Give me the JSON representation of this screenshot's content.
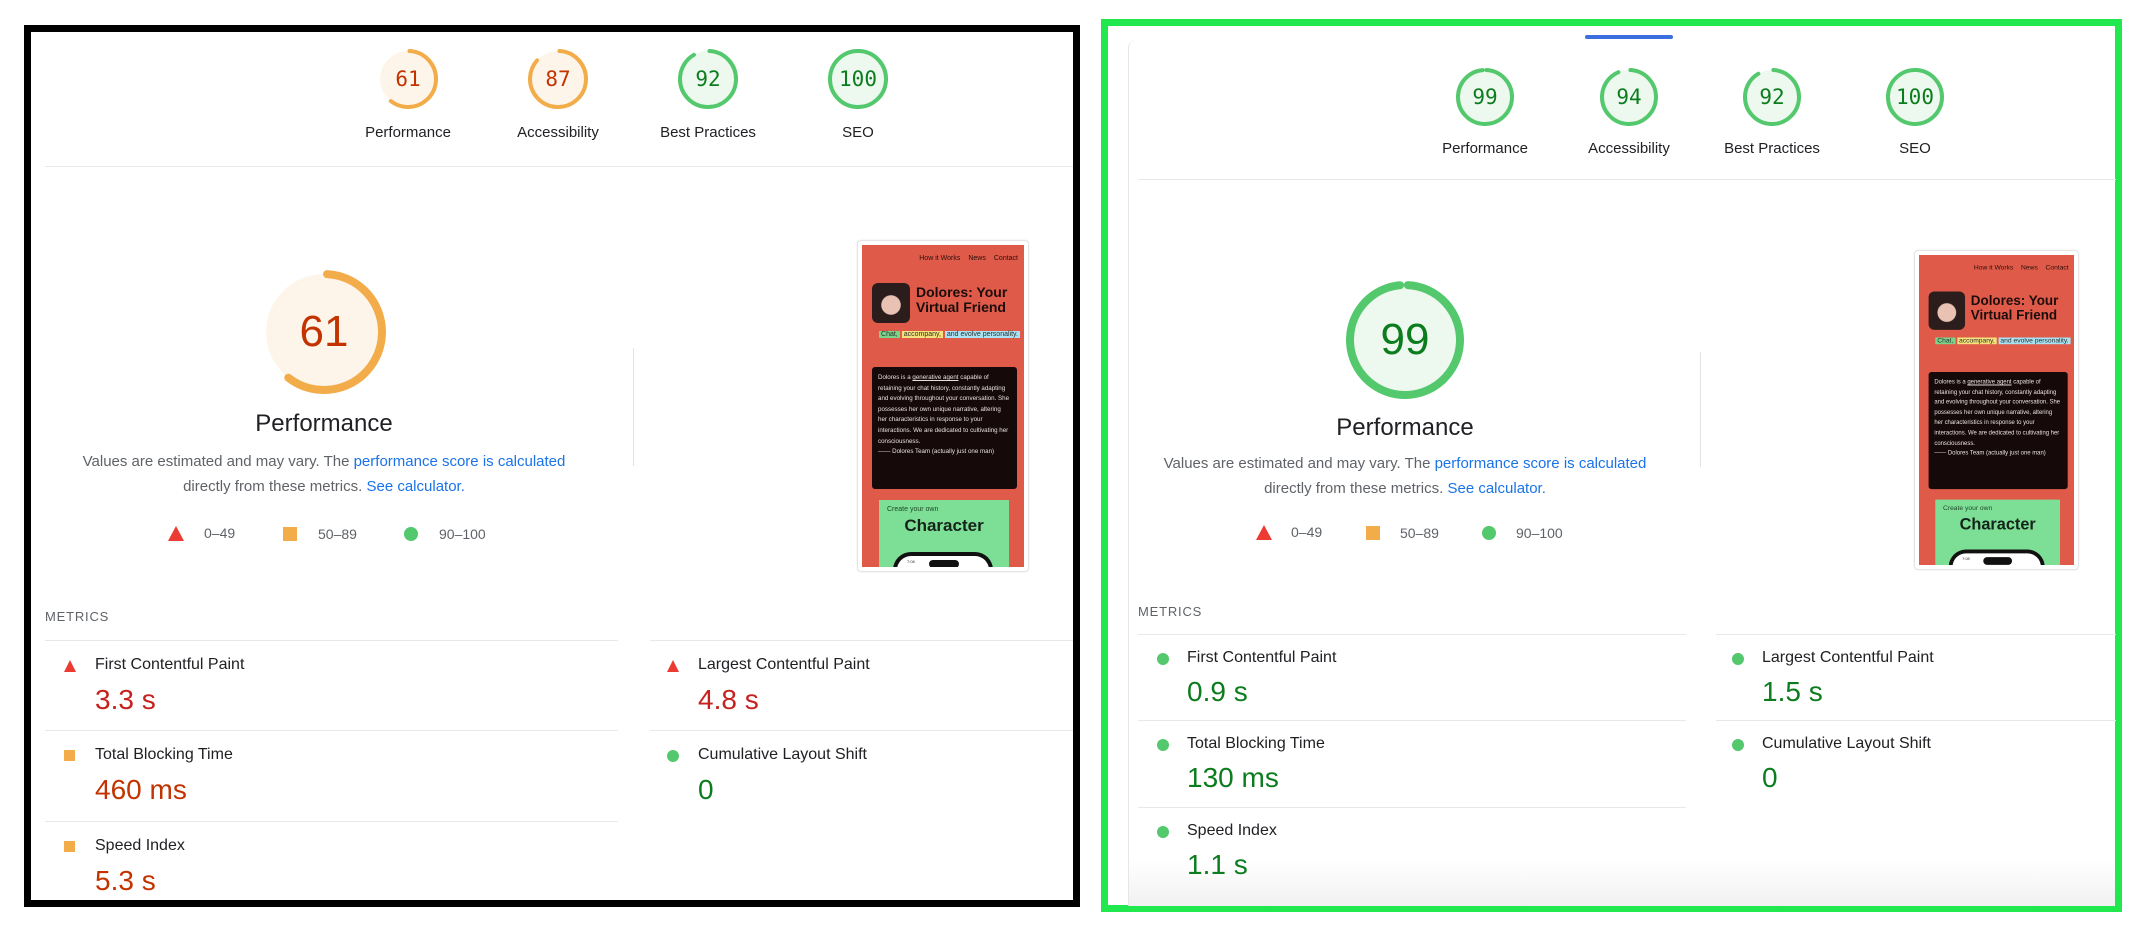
{
  "colors": {
    "pass": "#0c7d1e",
    "average": "#c33300",
    "fail": "#c5221f",
    "pass_ring": "#53c86c",
    "average_ring": "#f2ac4a",
    "fail_icon": "#eb3b32",
    "pass_bg": "#edf8ef",
    "average_bg": "#fdf5ea",
    "link": "#1a73e8",
    "left_frame": "#000000",
    "right_frame": "#22e84f"
  },
  "panels": [
    {
      "id": "before",
      "categories": [
        {
          "label": "Performance",
          "score": 61,
          "rating": "average"
        },
        {
          "label": "Accessibility",
          "score": 87,
          "rating": "average"
        },
        {
          "label": "Best Practices",
          "score": 92,
          "rating": "pass"
        },
        {
          "label": "SEO",
          "score": 100,
          "rating": "pass"
        }
      ],
      "main": {
        "score": 61,
        "rating": "average",
        "title": "Performance",
        "desc_prefix": "Values are estimated and may vary. The ",
        "desc_link1": "performance score is calculated",
        "desc_mid": " directly from these metrics. ",
        "desc_link2": "See calculator."
      },
      "legend": [
        {
          "icon": "fail-triangle-icon",
          "label": "0–49"
        },
        {
          "icon": "average-square-icon",
          "label": "50–89"
        },
        {
          "icon": "pass-circle-icon",
          "label": "90–100"
        }
      ],
      "metrics_label": "METRICS",
      "metrics": [
        {
          "title": "First Contentful Paint",
          "value": "3.3 s",
          "rating": "fail"
        },
        {
          "title": "Largest Contentful Paint",
          "value": "4.8 s",
          "rating": "fail"
        },
        {
          "title": "Total Blocking Time",
          "value": "460 ms",
          "rating": "average"
        },
        {
          "title": "Cumulative Layout Shift",
          "value": "0",
          "rating": "pass"
        },
        {
          "title": "Speed Index",
          "value": "5.3 s",
          "rating": "average"
        }
      ]
    },
    {
      "id": "after",
      "categories": [
        {
          "label": "Performance",
          "score": 99,
          "rating": "pass"
        },
        {
          "label": "Accessibility",
          "score": 94,
          "rating": "pass"
        },
        {
          "label": "Best Practices",
          "score": 92,
          "rating": "pass"
        },
        {
          "label": "SEO",
          "score": 100,
          "rating": "pass"
        }
      ],
      "main": {
        "score": 99,
        "rating": "pass",
        "title": "Performance",
        "desc_prefix": "Values are estimated and may vary. The ",
        "desc_link1": "performance score is calculated",
        "desc_mid": " directly from these metrics. ",
        "desc_link2": "See calculator."
      },
      "legend": [
        {
          "icon": "fail-triangle-icon",
          "label": "0–49"
        },
        {
          "icon": "average-square-icon",
          "label": "50–89"
        },
        {
          "icon": "pass-circle-icon",
          "label": "90–100"
        }
      ],
      "metrics_label": "METRICS",
      "metrics": [
        {
          "title": "First Contentful Paint",
          "value": "0.9 s",
          "rating": "pass"
        },
        {
          "title": "Largest Contentful Paint",
          "value": "1.5 s",
          "rating": "pass"
        },
        {
          "title": "Total Blocking Time",
          "value": "130 ms",
          "rating": "pass"
        },
        {
          "title": "Cumulative Layout Shift",
          "value": "0",
          "rating": "pass"
        },
        {
          "title": "Speed Index",
          "value": "1.1 s",
          "rating": "pass"
        }
      ]
    }
  ],
  "screenshot": {
    "nav": [
      "How it Works",
      "News",
      "Contact"
    ],
    "heading": "Dolores: Your Virtual Friend",
    "tags": [
      "Chat,",
      "accompany,",
      "and evolve personality."
    ],
    "body_pre": "Dolores is a ",
    "body_link": "generative agent",
    "body_post": " capable of retaining your chat history, constantly adapting and evolving throughout your conversation. She possesses her own unique narrative, altering her characteristics in response to your interactions. We are dedicated to cultivating her consciousness.",
    "signature": "—— Dolores Team (actually just one man)",
    "card_small": "Create your own",
    "card_big": "Character",
    "phone_time": "7:08"
  }
}
